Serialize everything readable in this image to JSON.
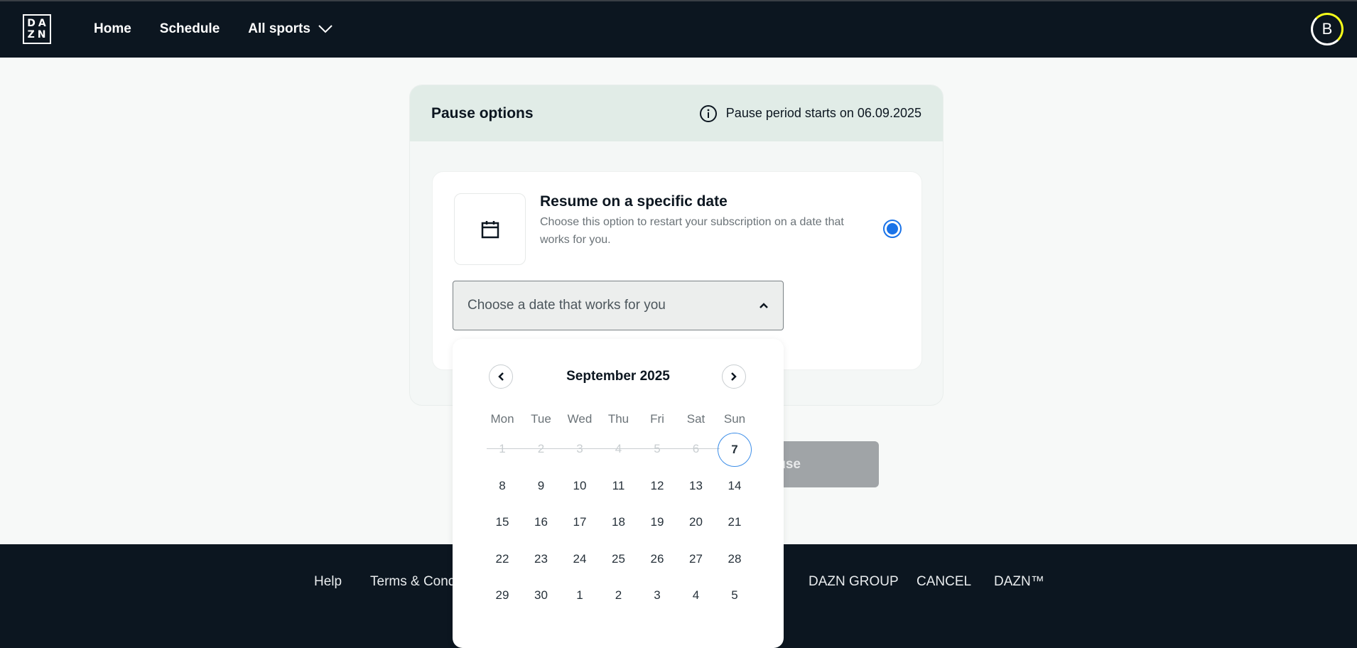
{
  "header": {
    "logo_top": "DA",
    "logo_bottom": "ZN",
    "nav": {
      "home": "Home",
      "schedule": "Schedule",
      "all_sports": "All sports"
    },
    "avatar_letter": "B"
  },
  "card": {
    "title": "Pause options",
    "pause_info": "Pause period starts on 06.09.2025",
    "option_title": "Resume on a specific date",
    "option_desc": "Choose this option to restart your subscription on a date that works for you.",
    "select_placeholder": "Choose a date that works for you",
    "pause_button": "Pause"
  },
  "calendar": {
    "month_label": "September 2025",
    "weekdays": [
      "Mon",
      "Tue",
      "Wed",
      "Thu",
      "Fri",
      "Sat",
      "Sun"
    ],
    "weeks": [
      [
        "1",
        "2",
        "3",
        "4",
        "5",
        "6",
        "7"
      ],
      [
        "8",
        "9",
        "10",
        "11",
        "12",
        "13",
        "14"
      ],
      [
        "15",
        "16",
        "17",
        "18",
        "19",
        "20",
        "21"
      ],
      [
        "22",
        "23",
        "24",
        "25",
        "26",
        "27",
        "28"
      ],
      [
        "29",
        "30",
        "1",
        "2",
        "3",
        "4",
        "5"
      ]
    ],
    "disabled_count": 6,
    "selected_day": "7"
  },
  "footer": {
    "help": "Help",
    "terms": "Terms & Cond",
    "group": "DAZN GROUP",
    "cancel": "CANCEL",
    "tm": "DAZN™"
  },
  "colors": {
    "brand_dark": "#0c1620",
    "accent_blue": "#1a73e8",
    "avatar_ring": "#f7ff1a"
  }
}
